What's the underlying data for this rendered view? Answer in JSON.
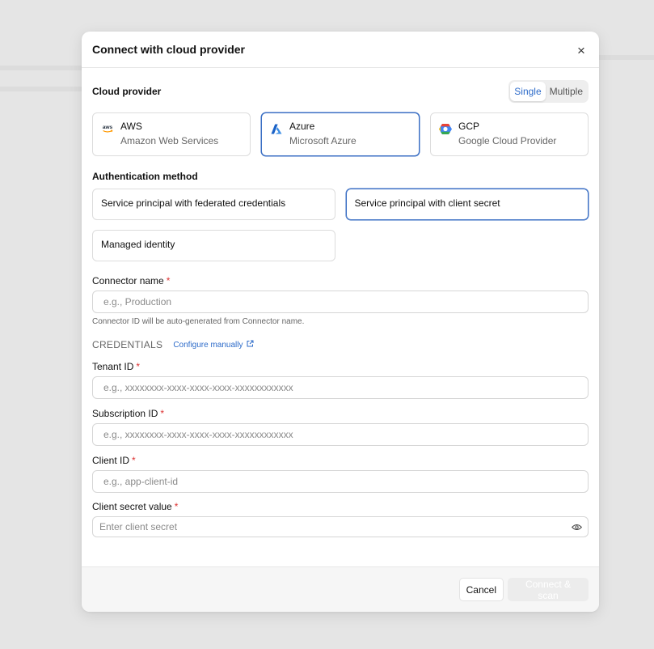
{
  "dialog": {
    "title": "Connect with cloud provider",
    "close_glyph": "×"
  },
  "cloud_provider": {
    "label": "Cloud provider",
    "mode_options": [
      "Single",
      "Multiple"
    ],
    "selected_mode": "Single",
    "providers": [
      {
        "name": "AWS",
        "subtitle": "Amazon Web Services",
        "icon": "aws-logo-icon",
        "selected": false
      },
      {
        "name": "Azure",
        "subtitle": "Microsoft Azure",
        "icon": "azure-logo-icon",
        "selected": true
      },
      {
        "name": "GCP",
        "subtitle": "Google Cloud Provider",
        "icon": "gcp-logo-icon",
        "selected": false
      }
    ],
    "aws_logo_text": "aws"
  },
  "auth": {
    "label": "Authentication method",
    "options": [
      {
        "label": "Service principal with federated credentials",
        "selected": false
      },
      {
        "label": "Service principal with client secret",
        "selected": true
      },
      {
        "label": "Managed identity",
        "selected": false
      }
    ]
  },
  "connector": {
    "label": "Connector name",
    "required_mark": "*",
    "placeholder": "e.g., Production",
    "value": "",
    "hint": "Connector ID will be auto-generated from Connector name."
  },
  "credentials": {
    "title": "CREDENTIALS",
    "configure_link": "Configure manually",
    "fields": [
      {
        "label": "Tenant ID",
        "required": true,
        "placeholder": "e.g., xxxxxxxx-xxxx-xxxx-xxxx-xxxxxxxxxxxx",
        "value": ""
      },
      {
        "label": "Subscription ID",
        "required": true,
        "placeholder": "e.g., xxxxxxxx-xxxx-xxxx-xxxx-xxxxxxxxxxxx",
        "value": ""
      },
      {
        "label": "Client ID",
        "required": true,
        "placeholder": "e.g., app-client-id",
        "value": ""
      }
    ],
    "secret": {
      "label": "Client secret value",
      "required": true,
      "placeholder": "Enter client secret",
      "value": ""
    }
  },
  "footer": {
    "cancel_label": "Cancel",
    "primary_label": "Connect & scan"
  },
  "colors": {
    "accent": "#2d6bc9",
    "selected_border": "#3b6fc4",
    "required": "#dd3333",
    "disabled_button": "#ececec"
  }
}
